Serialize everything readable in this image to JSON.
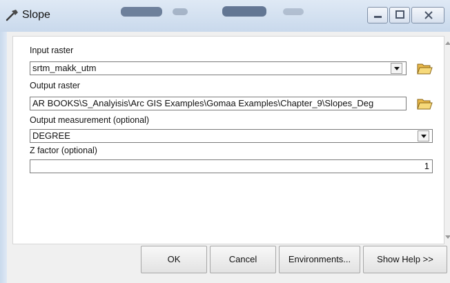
{
  "window": {
    "title": "Slope",
    "controls": {
      "minimize_icon": "minimize-icon",
      "maximize_icon": "maximize-icon",
      "close_icon": "close-icon"
    }
  },
  "form": {
    "input_raster": {
      "label": "Input raster",
      "value": "srtm_makk_utm"
    },
    "output_raster": {
      "label": "Output raster",
      "value": "AR BOOKS\\S_Analyisis\\Arc GIS Examples\\Gomaa Examples\\Chapter_9\\Slopes_Deg"
    },
    "output_measurement": {
      "label": "Output measurement (optional)",
      "value": "DEGREE"
    },
    "z_factor": {
      "label": "Z factor (optional)",
      "value": "1"
    }
  },
  "buttons": {
    "ok": "OK",
    "cancel": "Cancel",
    "environments": "Environments...",
    "show_help": "Show Help >>"
  },
  "colors": {
    "title_bar": "#c9d9ec",
    "dialog_bg": "#f0f0f0",
    "panel_bg": "#ffffff",
    "folder_yellow": "#f2c94c"
  }
}
